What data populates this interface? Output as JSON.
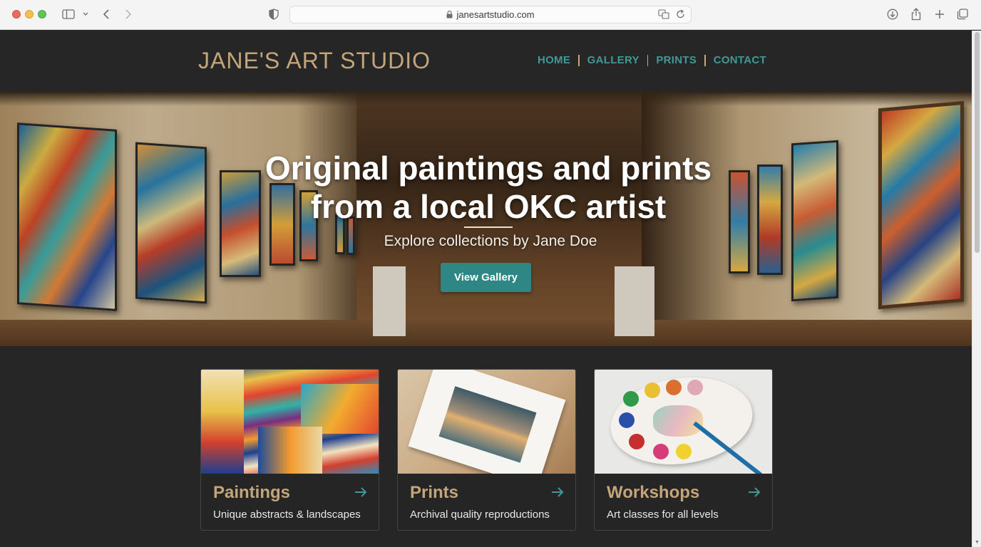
{
  "browser": {
    "url": "janesartstudio.com"
  },
  "header": {
    "logo": "JANE'S ART STUDIO",
    "nav": [
      "HOME",
      "GALLERY",
      "PRINTS",
      "CONTACT"
    ]
  },
  "hero": {
    "title_line1": "Original paintings and prints",
    "title_line2": "from a local OKC artist",
    "subtitle": "Explore collections by Jane Doe",
    "button": "View Gallery"
  },
  "cards": [
    {
      "title": "Paintings",
      "description": "Unique abstracts & landscapes"
    },
    {
      "title": "Prints",
      "description": "Archival quality reproductions"
    },
    {
      "title": "Workshops",
      "description": "Art classes for all levels"
    }
  ],
  "colors": {
    "accent": "#3f9a97",
    "gold": "#c4a57a",
    "background": "#262626"
  }
}
